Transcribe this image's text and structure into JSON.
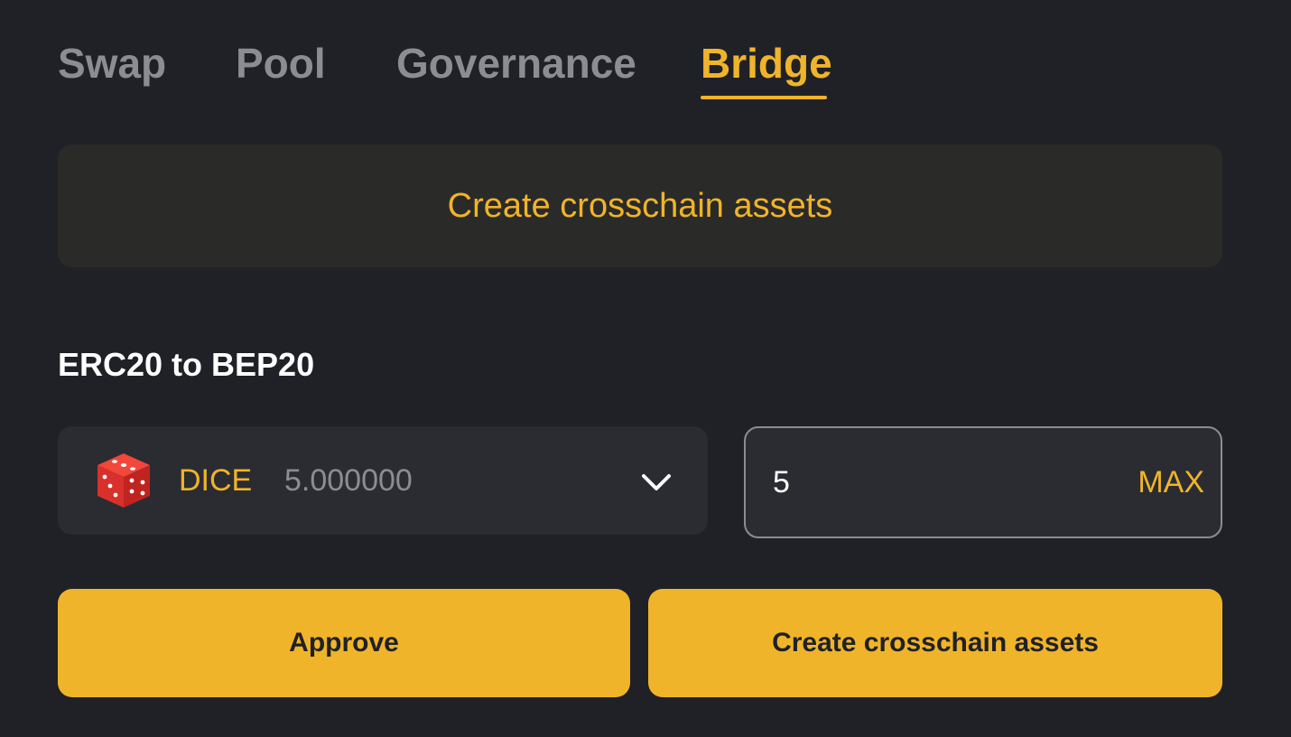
{
  "tabs": [
    {
      "label": "Swap",
      "active": false
    },
    {
      "label": "Pool",
      "active": false
    },
    {
      "label": "Governance",
      "active": false
    },
    {
      "label": "Bridge",
      "active": true
    }
  ],
  "banner": {
    "text": "Create crosschain assets"
  },
  "section": {
    "title": "ERC20 to BEP20"
  },
  "token_select": {
    "icon": "dice-icon",
    "symbol": "DICE",
    "balance": "5.000000"
  },
  "amount": {
    "value": "5",
    "max_label": "MAX"
  },
  "actions": {
    "approve_label": "Approve",
    "create_label": "Create crosschain assets"
  },
  "colors": {
    "background": "#1f2126",
    "accent": "#f0b42a",
    "muted": "#8b8d91",
    "surface": "#2a2c31"
  }
}
